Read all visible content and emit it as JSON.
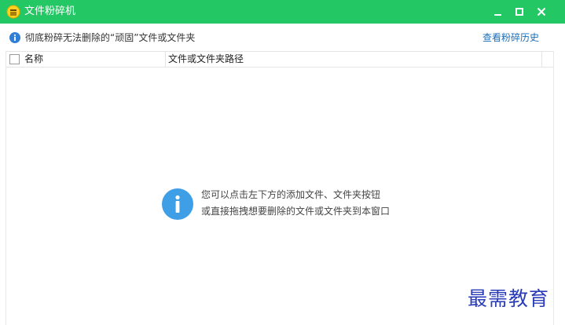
{
  "window": {
    "title": "文件粉碎机",
    "accent_color": "#23c864",
    "controls": [
      "minimize-icon",
      "maximize-icon",
      "close-icon"
    ]
  },
  "infobar": {
    "message": "彻底粉碎无法删除的“顽固”文件或文件夹",
    "history_link": "查看粉碎历史",
    "icon": "info-icon"
  },
  "table": {
    "columns": [
      "名称",
      "文件或文件夹路径"
    ],
    "rows": []
  },
  "empty_state": {
    "icon": "info-icon",
    "line1": "您可以点击左下方的添加文件、文件夹按钮",
    "line2": "或直接拖拽想要删除的文件或文件夹到本窗口"
  },
  "watermark": "最需教育"
}
